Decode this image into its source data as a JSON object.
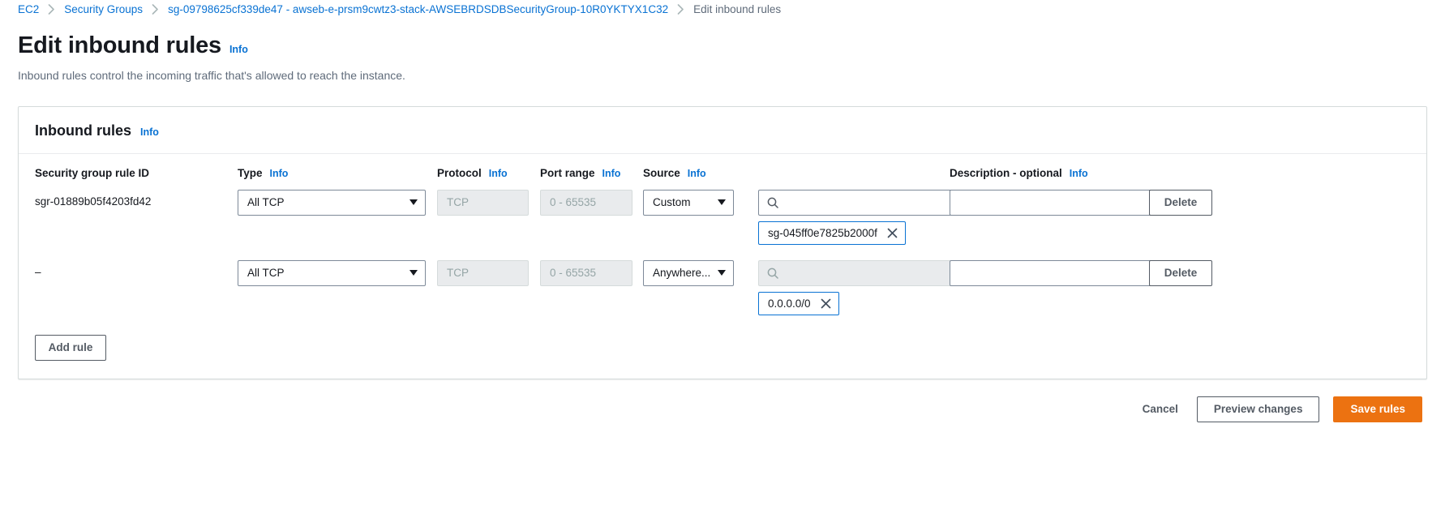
{
  "breadcrumb": {
    "items": [
      {
        "label": "EC2",
        "current": false
      },
      {
        "label": "Security Groups",
        "current": false
      },
      {
        "label": "sg-09798625cf339de47 - awseb-e-prsm9cwtz3-stack-AWSEBRDSDBSecurityGroup-10R0YKTYX1C32",
        "current": false
      },
      {
        "label": "Edit inbound rules",
        "current": true
      }
    ]
  },
  "page": {
    "title": "Edit inbound rules",
    "info_label": "Info",
    "description": "Inbound rules control the incoming traffic that's allowed to reach the instance."
  },
  "card": {
    "title": "Inbound rules",
    "info_label": "Info"
  },
  "columns": {
    "rule_id": "Security group rule ID",
    "type": "Type",
    "type_info": "Info",
    "protocol": "Protocol",
    "protocol_info": "Info",
    "port_range": "Port range",
    "port_range_info": "Info",
    "source": "Source",
    "source_info": "Info",
    "description": "Description - optional",
    "description_info": "Info"
  },
  "rules": [
    {
      "rule_id": "sgr-01889b05f4203fd42",
      "type": "All TCP",
      "protocol": "TCP",
      "port_range": "0 - 65535",
      "source_kind": "Custom",
      "source_search_value": "",
      "source_search_disabled": false,
      "source_token": "sg-045ff0e7825b2000f",
      "description": "",
      "delete_label": "Delete"
    },
    {
      "rule_id": "–",
      "type": "All TCP",
      "protocol": "TCP",
      "port_range": "0 - 65535",
      "source_kind": "Anywhere...",
      "source_search_value": "",
      "source_search_disabled": true,
      "source_token": "0.0.0.0/0",
      "description": "",
      "delete_label": "Delete"
    }
  ],
  "actions": {
    "add_rule": "Add rule",
    "cancel": "Cancel",
    "preview_changes": "Preview changes",
    "save_rules": "Save rules"
  },
  "icons": {
    "search": "search-icon",
    "chevron_right": "chevron-right-icon",
    "close": "close-icon",
    "caret_down": "chevron-down-icon"
  },
  "colors": {
    "link": "#0972d3",
    "primary": "#ec7211",
    "token_border": "#0972d3",
    "text": "#16191f",
    "muted": "#5f6b7a"
  }
}
